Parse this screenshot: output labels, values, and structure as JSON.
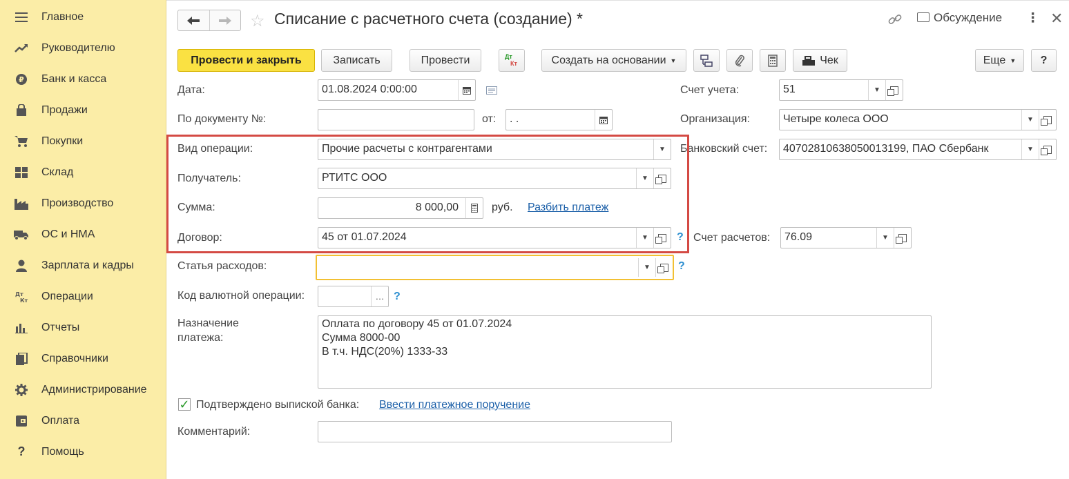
{
  "sidebar": {
    "items": [
      {
        "label": "Главное",
        "icon": "menu-icon"
      },
      {
        "label": "Руководителю",
        "icon": "trend-icon"
      },
      {
        "label": "Банк и касса",
        "icon": "bank-coin-icon"
      },
      {
        "label": "Продажи",
        "icon": "shopping-bag-icon"
      },
      {
        "label": "Покупки",
        "icon": "cart-icon"
      },
      {
        "label": "Склад",
        "icon": "warehouse-icon"
      },
      {
        "label": "Производство",
        "icon": "factory-icon"
      },
      {
        "label": "ОС и НМА",
        "icon": "truck-icon"
      },
      {
        "label": "Зарплата и кадры",
        "icon": "person-icon"
      },
      {
        "label": "Операции",
        "icon": "dt-kt-icon"
      },
      {
        "label": "Отчеты",
        "icon": "bar-chart-icon"
      },
      {
        "label": "Справочники",
        "icon": "books-icon"
      },
      {
        "label": "Администрирование",
        "icon": "gear-icon"
      },
      {
        "label": "Оплата",
        "icon": "wallet-icon"
      },
      {
        "label": "Помощь",
        "icon": "question-icon"
      }
    ]
  },
  "header": {
    "title": "Списание с расчетного счета (создание) *",
    "discussion": "Обсуждение"
  },
  "toolbar": {
    "post_close": "Провести и закрыть",
    "save": "Записать",
    "post": "Провести",
    "dtkt_top": "Дт",
    "dtkt_bottom": "Кт",
    "create_based": "Создать на основании",
    "receipt": "Чек",
    "more": "Еще",
    "help": "?"
  },
  "form": {
    "date_label": "Дата:",
    "date_value": "01.08.2024  0:00:00",
    "docnum_label": "По документу №:",
    "docnum_value": "",
    "from_label": "от:",
    "from_value": " .  .",
    "optype_label": "Вид операции:",
    "optype_value": "Прочие расчеты с контрагентами",
    "recipient_label": "Получатель:",
    "recipient_value": "РТИТС ООО",
    "amount_label": "Сумма:",
    "amount_value": "8 000,00",
    "currency": "руб.",
    "split_link": "Разбить платеж",
    "contract_label": "Договор:",
    "contract_value": "45 от 01.07.2024",
    "expense_label": "Статья расходов:",
    "expense_value": "",
    "currency_op_label": "Код валютной операции:",
    "currency_op_value": "",
    "purpose_label": "Назначение\nплатежа:",
    "purpose_value": "Оплата по договору 45 от 01.07.2024\nСумма 8000-00\nВ т.ч. НДС(20%) 1333-33",
    "confirmed_label": "Подтверждено выпиской банка:",
    "confirmed_checked": true,
    "payment_order_link": "Ввести платежное поручение",
    "comment_label": "Комментарий:",
    "comment_value": "",
    "account_label": "Счет учета:",
    "account_value": "51",
    "org_label": "Организация:",
    "org_value": "Четыре колеса ООО",
    "bank_account_label": "Банковский счет:",
    "bank_account_value": "40702810638050013199, ПАО Сбербанк",
    "settlement_label": "Счет расчетов:",
    "settlement_value": "76.09",
    "qmark": "?"
  },
  "colors": {
    "sidebar_bg": "#fbeda7",
    "primary_button": "#fae142",
    "highlight_frame": "#d44a44",
    "link": "#1b5fa8"
  }
}
